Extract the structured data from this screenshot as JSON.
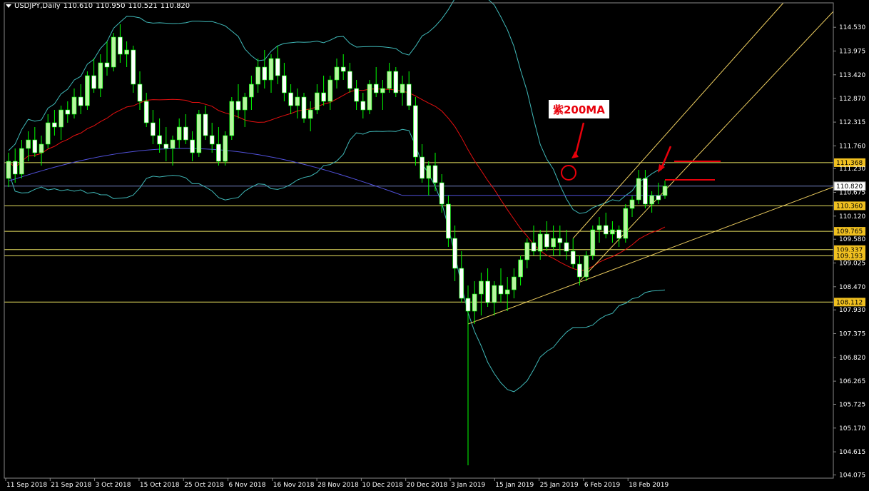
{
  "header": {
    "symbol": "USDJPY,Daily",
    "open": "110.610",
    "high": "110.950",
    "low": "110.521",
    "close": "110.820"
  },
  "annotation": {
    "text": "紫200MA"
  },
  "colors": {
    "background": "#000000",
    "bull_candle": "#b7f5a0",
    "bear_candle": "#ffffff",
    "wick": "#00ff00",
    "bollinger": "#3fb8b8",
    "ma_mid": "#e81010",
    "ma200": "#5050d8",
    "hlines": "#e8e060",
    "trendline": "#f0d060",
    "annotation": "#e8000b",
    "price_line": "#7080c0"
  },
  "chart_data": {
    "type": "candlestick",
    "instrument": "USDJPY",
    "timeframe": "Daily",
    "ylim": [
      104.0,
      115.1
    ],
    "y_ticks": [
      "114.530",
      "113.975",
      "113.420",
      "112.870",
      "112.315",
      "111.760",
      "111.230",
      "110.675",
      "110.120",
      "109.580",
      "109.025",
      "108.470",
      "107.930",
      "107.375",
      "106.820",
      "106.265",
      "105.725",
      "105.170",
      "104.615",
      "104.075"
    ],
    "x_ticks": [
      "11 Sep 2018",
      "21 Sep 2018",
      "3 Oct 2018",
      "15 Oct 2018",
      "25 Oct 2018",
      "6 Nov 2018",
      "16 Nov 2018",
      "28 Nov 2018",
      "10 Dec 2018",
      "20 Dec 2018",
      "3 Jan 2019",
      "15 Jan 2019",
      "25 Jan 2019",
      "6 Feb 2019",
      "18 Feb 2019"
    ],
    "horizontal_levels": [
      {
        "label": "111.368",
        "value": 111.368
      },
      {
        "label": "110.360",
        "value": 110.36
      },
      {
        "label": "109.765",
        "value": 109.765
      },
      {
        "label": "109.337",
        "value": 109.337
      },
      {
        "label": "109.193",
        "value": 109.193
      },
      {
        "label": "108.112",
        "value": 108.112
      }
    ],
    "current_price": {
      "label": "110.820",
      "value": 110.82
    },
    "candles": [
      [
        111.0,
        111.6,
        110.8,
        111.4
      ],
      [
        111.4,
        111.7,
        110.9,
        111.1
      ],
      [
        111.1,
        111.9,
        111.0,
        111.7
      ],
      [
        111.7,
        112.1,
        111.4,
        111.9
      ],
      [
        111.9,
        112.2,
        111.5,
        111.6
      ],
      [
        111.6,
        112.0,
        111.3,
        111.8
      ],
      [
        111.8,
        112.5,
        111.7,
        112.3
      ],
      [
        112.3,
        112.6,
        112.0,
        112.2
      ],
      [
        112.2,
        112.7,
        111.9,
        112.6
      ],
      [
        112.6,
        112.8,
        112.3,
        112.5
      ],
      [
        112.5,
        113.1,
        112.4,
        112.9
      ],
      [
        112.9,
        113.2,
        112.5,
        112.7
      ],
      [
        112.7,
        113.5,
        112.6,
        113.4
      ],
      [
        113.4,
        113.8,
        113.0,
        113.1
      ],
      [
        113.1,
        113.9,
        112.9,
        113.7
      ],
      [
        113.7,
        114.2,
        113.4,
        113.6
      ],
      [
        113.6,
        114.4,
        113.5,
        114.3
      ],
      [
        114.3,
        114.6,
        113.7,
        113.9
      ],
      [
        113.9,
        114.2,
        113.6,
        114.0
      ],
      [
        114.0,
        114.1,
        113.0,
        113.2
      ],
      [
        113.2,
        113.5,
        112.6,
        112.8
      ],
      [
        112.8,
        113.0,
        112.2,
        112.3
      ],
      [
        112.3,
        112.6,
        111.8,
        112.0
      ],
      [
        112.0,
        112.4,
        111.6,
        111.8
      ],
      [
        111.8,
        112.2,
        111.4,
        111.7
      ],
      [
        111.7,
        112.0,
        111.3,
        111.9
      ],
      [
        111.9,
        112.4,
        111.7,
        112.2
      ],
      [
        112.2,
        112.5,
        111.8,
        111.9
      ],
      [
        111.9,
        112.1,
        111.4,
        111.6
      ],
      [
        111.6,
        112.6,
        111.5,
        112.5
      ],
      [
        112.5,
        112.7,
        111.9,
        112.0
      ],
      [
        112.0,
        112.3,
        111.6,
        111.8
      ],
      [
        111.8,
        112.2,
        111.3,
        111.4
      ],
      [
        111.4,
        112.1,
        111.3,
        112.0
      ],
      [
        112.0,
        112.9,
        111.9,
        112.8
      ],
      [
        112.8,
        113.2,
        112.4,
        112.6
      ],
      [
        112.6,
        113.0,
        112.2,
        112.9
      ],
      [
        112.9,
        113.4,
        112.6,
        113.2
      ],
      [
        113.2,
        113.8,
        113.0,
        113.6
      ],
      [
        113.6,
        114.0,
        113.1,
        113.3
      ],
      [
        113.3,
        113.9,
        113.0,
        113.8
      ],
      [
        113.8,
        114.1,
        113.2,
        113.4
      ],
      [
        113.4,
        113.7,
        112.8,
        113.0
      ],
      [
        113.0,
        113.2,
        112.5,
        112.7
      ],
      [
        112.7,
        113.1,
        112.4,
        112.9
      ],
      [
        112.9,
        113.0,
        112.3,
        112.4
      ],
      [
        112.4,
        112.8,
        112.1,
        112.6
      ],
      [
        112.6,
        113.2,
        112.5,
        113.0
      ],
      [
        113.0,
        113.4,
        112.7,
        112.8
      ],
      [
        112.8,
        113.4,
        112.6,
        113.3
      ],
      [
        113.3,
        113.8,
        113.1,
        113.6
      ],
      [
        113.6,
        113.9,
        113.3,
        113.5
      ],
      [
        113.5,
        113.7,
        113.0,
        113.1
      ],
      [
        113.1,
        113.3,
        112.6,
        112.8
      ],
      [
        112.8,
        113.0,
        112.4,
        112.6
      ],
      [
        112.6,
        113.3,
        112.5,
        113.2
      ],
      [
        113.2,
        113.6,
        112.9,
        113.0
      ],
      [
        113.0,
        113.3,
        112.6,
        113.1
      ],
      [
        113.1,
        113.7,
        113.0,
        113.5
      ],
      [
        113.5,
        113.6,
        112.9,
        113.0
      ],
      [
        113.0,
        113.4,
        112.7,
        113.2
      ],
      [
        113.2,
        113.5,
        112.6,
        112.7
      ],
      [
        112.7,
        112.9,
        111.3,
        111.5
      ],
      [
        111.5,
        111.8,
        110.9,
        111.0
      ],
      [
        111.0,
        111.4,
        110.6,
        111.3
      ],
      [
        111.3,
        111.6,
        110.7,
        110.9
      ],
      [
        110.9,
        111.1,
        110.2,
        110.4
      ],
      [
        110.4,
        110.6,
        109.4,
        109.6
      ],
      [
        109.6,
        109.9,
        108.6,
        108.9
      ],
      [
        108.9,
        109.3,
        108.1,
        108.2
      ],
      [
        108.2,
        108.5,
        104.3,
        107.9
      ],
      [
        107.9,
        108.6,
        107.6,
        108.3
      ],
      [
        108.3,
        108.8,
        107.8,
        108.6
      ],
      [
        108.6,
        108.9,
        108.0,
        108.1
      ],
      [
        108.1,
        108.6,
        107.8,
        108.5
      ],
      [
        108.5,
        108.9,
        108.1,
        108.3
      ],
      [
        108.3,
        108.7,
        107.9,
        108.4
      ],
      [
        108.4,
        108.9,
        108.2,
        108.7
      ],
      [
        108.7,
        109.2,
        108.5,
        109.1
      ],
      [
        109.1,
        109.6,
        108.9,
        109.5
      ],
      [
        109.5,
        109.9,
        109.2,
        109.3
      ],
      [
        109.3,
        109.8,
        109.1,
        109.7
      ],
      [
        109.7,
        110.0,
        109.3,
        109.4
      ],
      [
        109.4,
        109.9,
        109.2,
        109.6
      ],
      [
        109.6,
        109.9,
        109.2,
        109.5
      ],
      [
        109.5,
        109.8,
        109.1,
        109.3
      ],
      [
        109.3,
        109.6,
        108.9,
        109.0
      ],
      [
        109.0,
        109.2,
        108.5,
        108.7
      ],
      [
        108.7,
        109.3,
        108.6,
        109.2
      ],
      [
        109.2,
        109.9,
        109.1,
        109.8
      ],
      [
        109.8,
        110.1,
        109.5,
        109.9
      ],
      [
        109.9,
        110.2,
        109.6,
        109.7
      ],
      [
        109.7,
        110.0,
        109.5,
        109.8
      ],
      [
        109.8,
        109.9,
        109.4,
        109.6
      ],
      [
        109.6,
        110.4,
        109.5,
        110.3
      ],
      [
        110.3,
        110.6,
        110.1,
        110.5
      ],
      [
        110.5,
        111.2,
        110.4,
        111.0
      ],
      [
        111.0,
        111.2,
        110.3,
        110.4
      ],
      [
        110.4,
        110.7,
        110.2,
        110.6
      ],
      [
        110.6,
        110.9,
        110.4,
        110.5
      ],
      [
        110.6,
        110.95,
        110.52,
        110.82
      ]
    ],
    "overlays": [
      {
        "type": "bollinger_upper"
      },
      {
        "type": "bollinger_lower"
      },
      {
        "type": "ma_mid"
      },
      {
        "type": "ma200"
      },
      {
        "type": "channel_upper"
      },
      {
        "type": "channel_lower"
      },
      {
        "type": "support_trendline"
      }
    ]
  }
}
